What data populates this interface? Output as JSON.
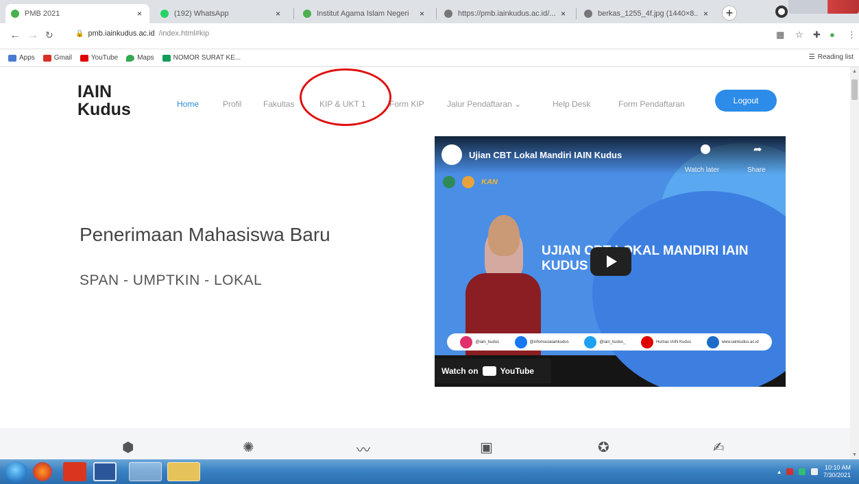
{
  "browser": {
    "tabs": [
      {
        "title": "PMB 2021",
        "active": true
      },
      {
        "title": "(192) WhatsApp",
        "active": false
      },
      {
        "title": "Institut Agama Islam Negeri",
        "active": false
      },
      {
        "title": "https://pmb.iainkudus.ac.id/...",
        "active": false
      },
      {
        "title": "berkas_1255_4f.jpg (1440×8...",
        "active": false
      }
    ],
    "tab_close_glyph": "×",
    "new_tab_glyph": "+",
    "url_host": "pmb.iainkudus.ac.id",
    "url_path": "/index.html#kip",
    "bookmarks": [
      {
        "label": "Apps",
        "icon": "apps-grid-icon",
        "color": "#4a7bd0"
      },
      {
        "label": "Gmail",
        "icon": "gmail-icon",
        "color": "#d93025"
      },
      {
        "label": "YouTube",
        "icon": "youtube-icon",
        "color": "#e00000"
      },
      {
        "label": "Maps",
        "icon": "maps-pin-icon",
        "color": "#34a853"
      },
      {
        "label": "NOMOR SURAT KE...",
        "icon": "sheets-icon",
        "color": "#0f9d58"
      }
    ],
    "reading_list": "Reading list"
  },
  "page": {
    "logo_line1": "IAIN",
    "logo_line2": "Kudus",
    "nav": [
      {
        "label": "Home",
        "active": true
      },
      {
        "label": "Profil",
        "active": false
      },
      {
        "label": "Fakultas",
        "active": false
      },
      {
        "label": "KIP & UKT 1",
        "active": false
      },
      {
        "label": "Form KIP",
        "active": false
      },
      {
        "label": "Jalur Pendaftaran ⌄",
        "active": false
      },
      {
        "label": "Help Desk",
        "active": false
      },
      {
        "label": "Form Pendaftaran",
        "active": false
      }
    ],
    "logout": "Logout",
    "accent": "#2d8ce8",
    "annotation_color": "#e01010",
    "hero_title": "Penerimaan Mahasiswa Baru",
    "hero_sub": "SPAN - UMPTKIN - LOKAL"
  },
  "video": {
    "title": "Ujian CBT Lokal Mandiri IAIN Kudus",
    "watch_later": "Watch later",
    "share": "Share",
    "kan_label": "KAN",
    "headline": "UJIAN CBT LOKAL MANDIRI IAIN KUDUS",
    "socials": [
      {
        "label": "@iain_kudus",
        "color": "#e1306c"
      },
      {
        "label": "@infomasiaiainkudus",
        "color": "#1877f2"
      },
      {
        "label": "@iain_kudus_",
        "color": "#1da1f2"
      },
      {
        "label": "Humas IAIN Kudus",
        "color": "#e00000"
      },
      {
        "label": "www.iainkudus.ac.id",
        "color": "#1e6ac8"
      }
    ],
    "watch_on": "Watch on",
    "youtube": "YouTube"
  },
  "taskbar": {
    "time": "10:10 AM",
    "date": "7/30/2021"
  }
}
